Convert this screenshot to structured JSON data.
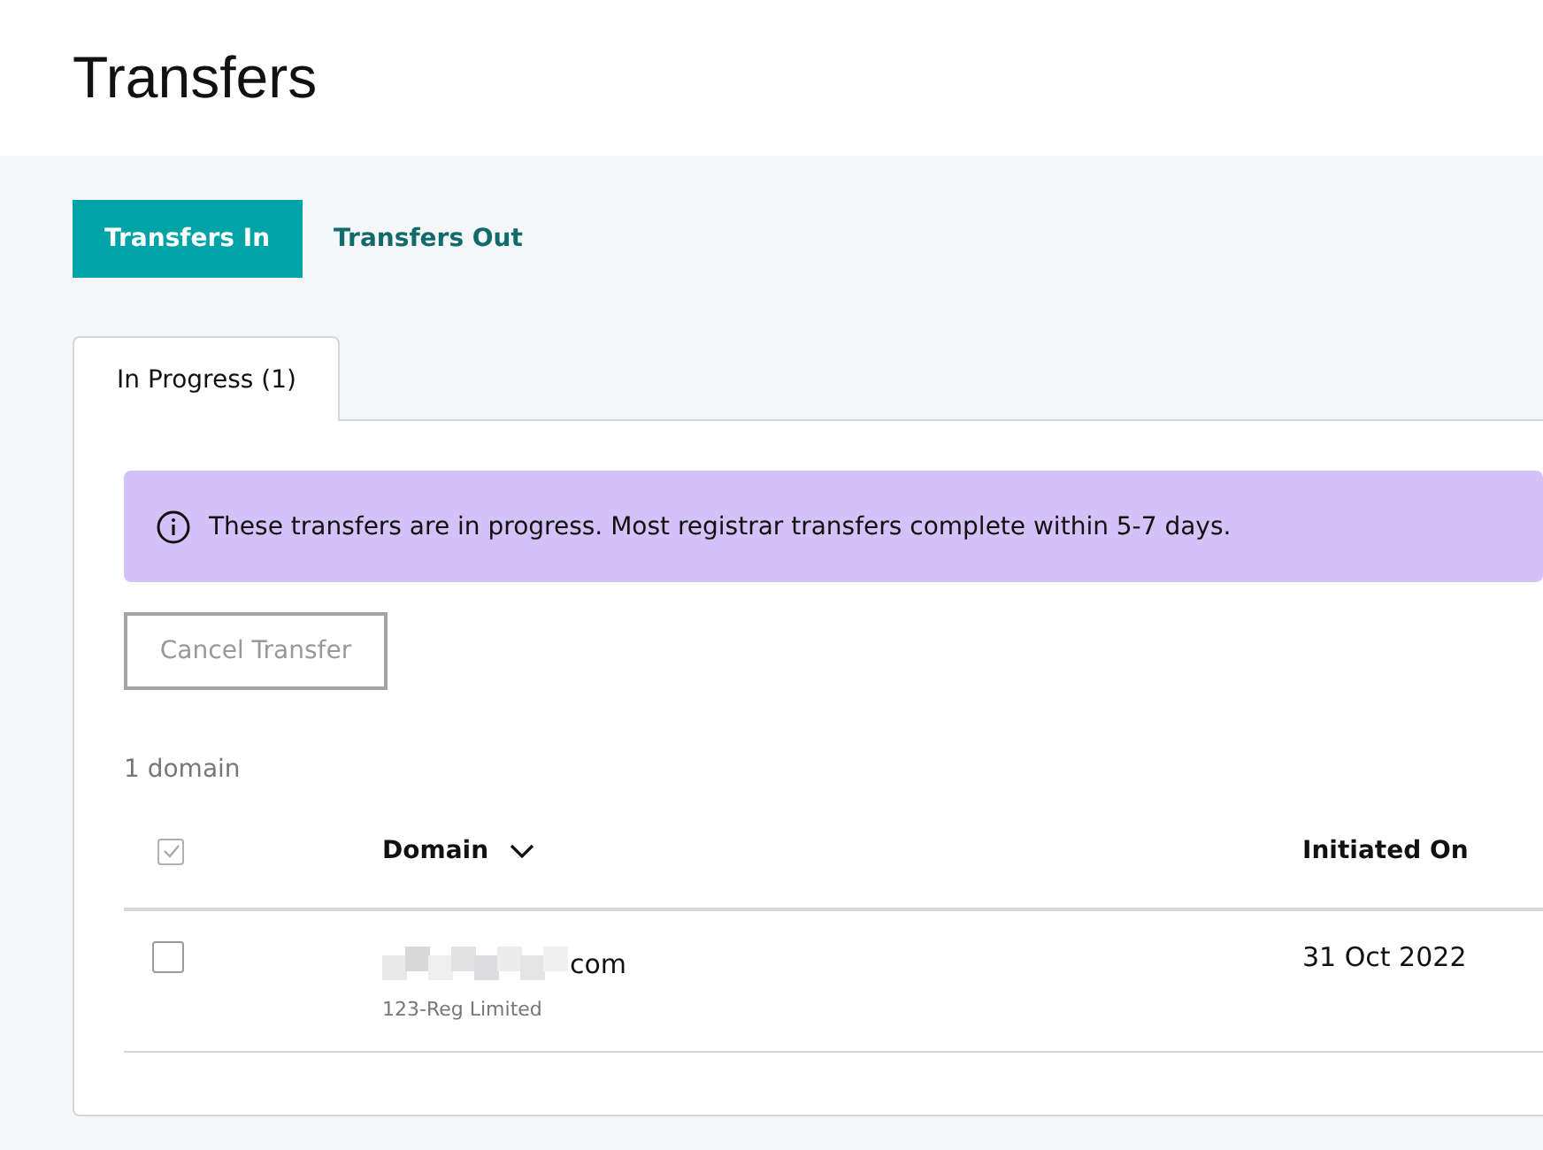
{
  "page": {
    "title": "Transfers"
  },
  "segments": [
    {
      "label": "Transfers In",
      "selected": true
    },
    {
      "label": "Transfers Out",
      "selected": false
    }
  ],
  "tabs": [
    {
      "label": "In Progress (1)",
      "selected": true
    }
  ],
  "banner": {
    "text": "These transfers are in progress. Most registrar transfers complete within 5-7 days."
  },
  "cancel_button": {
    "label": "Cancel Transfer",
    "disabled": true
  },
  "count": "1 domain",
  "table": {
    "select_all": {
      "checked": true,
      "disabled": true
    },
    "columns": [
      {
        "label": "Domain",
        "sortable": true
      },
      {
        "label": "Initiated On",
        "sortable": false
      }
    ],
    "rows": [
      {
        "checked": false,
        "domain": "com",
        "redacted": true,
        "registrar": "123-Reg Limited",
        "initiated": "31 Oct 2022"
      }
    ]
  }
}
